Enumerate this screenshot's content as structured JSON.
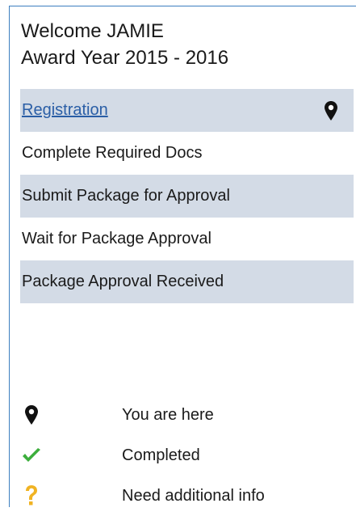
{
  "header": {
    "welcome": "Welcome JAMIE",
    "award_year": "Award Year 2015 - 2016"
  },
  "steps": [
    {
      "label": "Registration",
      "link": true,
      "current": true
    },
    {
      "label": "Complete Required Docs"
    },
    {
      "label": "Submit Package for Approval"
    },
    {
      "label": "Wait for Package Approval"
    },
    {
      "label": "Package Approval Received"
    }
  ],
  "legend": {
    "you_are_here": {
      "icon": "map-pin-icon",
      "text": "You are here"
    },
    "completed": {
      "icon": "checkmark-icon",
      "text": "Completed",
      "color": "#3cae3c"
    },
    "need_info": {
      "icon": "question-mark-icon",
      "text": "Need additional info",
      "color": "#f0b323"
    }
  },
  "colors": {
    "border": "#3d7fbf",
    "row_shade": "#d3dbe6",
    "link": "#2a5ea6"
  }
}
